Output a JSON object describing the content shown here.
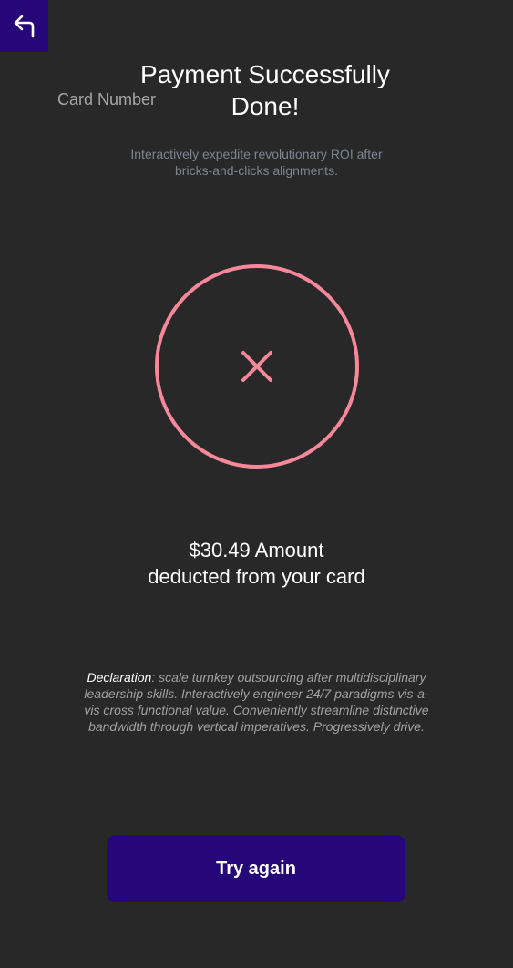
{
  "header": {
    "back_icon": "back-arrow-icon",
    "back_button_color": "#250779"
  },
  "card_label": "Card Number",
  "title": {
    "line1": "Payment Successfully",
    "line2": "Done!"
  },
  "subtitle": {
    "line1": "Interactively expedite revolutionary ROI after",
    "line2": "bricks-and-clicks alignments."
  },
  "status": {
    "icon": "close-x-icon",
    "color": "#f6889a"
  },
  "amount": {
    "line1": "$30.49 Amount",
    "line2": "deducted from your card"
  },
  "declaration": {
    "label": "Declaration",
    "text": ": scale turnkey outsourcing after multidisciplinary leadership skills. Interactively engineer 24/7 paradigms vis-a-vis cross functional value. Conveniently streamline distinctive bandwidth through vertical imperatives. Progressively drive."
  },
  "action": {
    "try_again_label": "Try again",
    "button_color": "#250779"
  }
}
